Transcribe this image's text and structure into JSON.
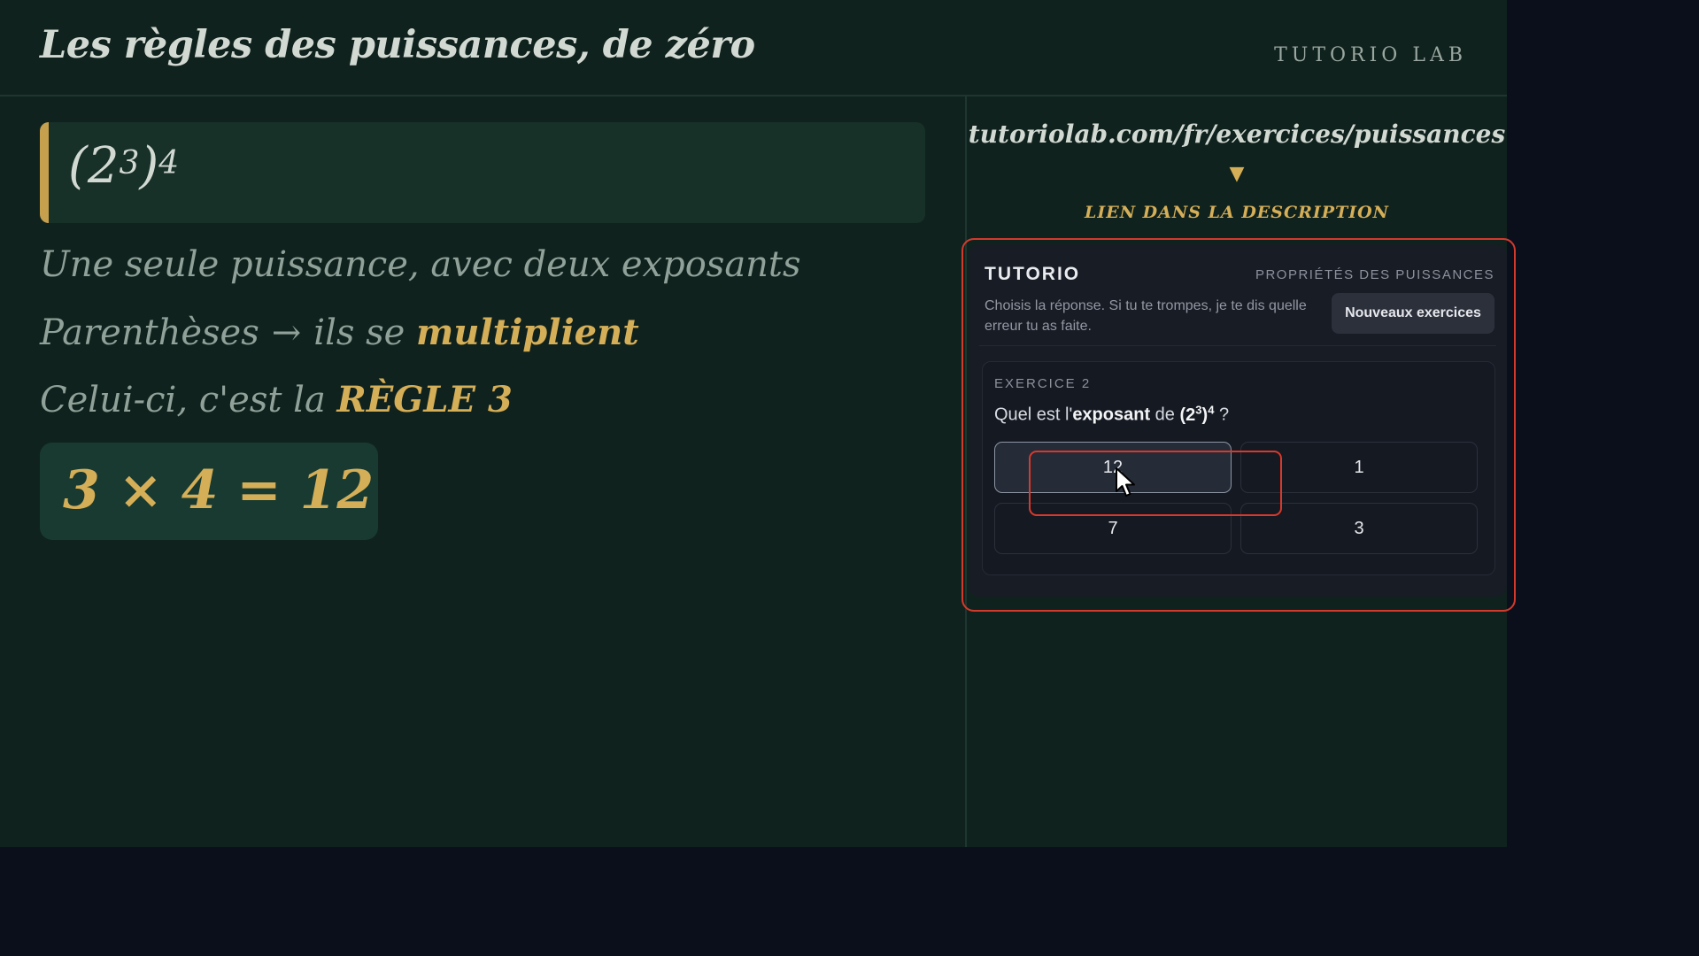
{
  "header": {
    "title": "Les règles des puissances, de zéro",
    "brand": "TUTORIO LAB"
  },
  "lesson": {
    "formula": {
      "base": "(2",
      "exp_inner": "3",
      "close": ")",
      "exp_outer": "4"
    },
    "line1": "Une seule puissance, avec deux exposants",
    "line2": {
      "prefix": "Parenthèses",
      "arrow": "→",
      "middle": "ils se",
      "highlight": "multiplient"
    },
    "line3": {
      "prefix": "Celui-ci, c'est la",
      "highlight": "RÈGLE 3"
    },
    "calculation": "3 × 4 = 12"
  },
  "link": {
    "url": "tutoriolab.com/fr/exercices/puissances",
    "arrow": "▼",
    "note": "LIEN DANS LA DESCRIPTION"
  },
  "widget": {
    "name": "TUTORIO",
    "topic": "PROPRIÉTÉS DES PUISSANCES",
    "instructions": "Choisis la réponse. Si tu te trompes, je te dis quelle erreur tu as faite.",
    "new_button": "Nouveaux exercices",
    "exercise": {
      "label": "EXERCICE 2",
      "question": {
        "prefix": "Quel est l'",
        "bold": "exposant",
        "middle": " de ",
        "expr_base": "(2",
        "expr_exp_inner": "3",
        "expr_close": ")",
        "expr_exp_outer": "4",
        "suffix": " ?"
      },
      "answers": [
        "12",
        "1",
        "7",
        "3"
      ],
      "selected_answer": "12"
    }
  },
  "colors": {
    "board": "#10221d",
    "accent_gold": "#d5ae58",
    "highlight_red": "#d33a2c",
    "widget_bg": "#181c25",
    "page_bg": "#0b0f1b"
  },
  "icons": {
    "link_arrow": "triangle-down-icon",
    "cursor": "mouse-pointer-icon"
  }
}
